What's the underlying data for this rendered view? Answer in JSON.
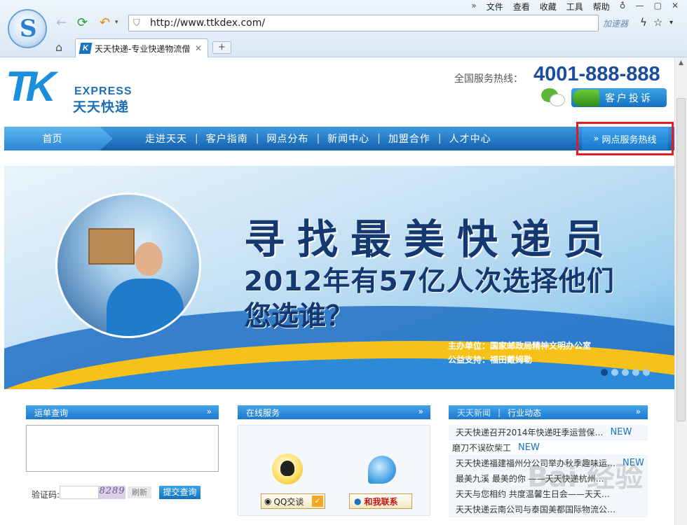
{
  "browser": {
    "menu": [
      "文件",
      "查看",
      "收藏",
      "工具",
      "帮助"
    ],
    "url": "http://www.ttkdex.com/",
    "accelerator": "加速器",
    "tab_title": "天天快递-专业快递物流僧",
    "tab_icon_text": "K",
    "colors": {
      "chrome": "#dbe8f4",
      "accent": "#1c6fb8"
    }
  },
  "header": {
    "logo_mark": "TK",
    "logo_express": "EXPRESS",
    "logo_cn": "天天快递",
    "hotline_label": "全国服务热线：",
    "hotline_number": "4001-888-888",
    "complain_label": "客户投诉"
  },
  "nav": {
    "home": "首页",
    "items": [
      "走进天天",
      "客户指南",
      "网点分布",
      "新闻中心",
      "加盟合作",
      "人才中心"
    ],
    "highlight": "网点服务热线",
    "highlight_prefix": "»"
  },
  "banner": {
    "headline": "寻找最美快递员",
    "line2": "2012年有57亿人次选择他们",
    "line3": "您选谁？",
    "credit1": "主办单位：国家邮政局精神文明办公室",
    "credit2": "公益支持：福田戴姆勒",
    "dots": 5,
    "active_dot": 0
  },
  "waybill": {
    "title": "运单查询",
    "captcha_label": "验证码:",
    "captcha_value": "8289",
    "refresh": "刷新",
    "submit": "提交查询"
  },
  "online": {
    "title": "在线服务",
    "qq_label": "QQ交谈",
    "ww_label": "和我联系"
  },
  "news": {
    "tab1": "天天新闻",
    "tab2": "行业动态",
    "new_badge": "NEW",
    "items": [
      {
        "text": "天天快递召开2014年快递旺季运营保…",
        "new": true
      },
      {
        "text": "磨刀不误砍柴工",
        "new": true
      },
      {
        "text": "天天快递福建福州分公司举办秋季趣味运…",
        "new": true
      },
      {
        "text": "最美九溪 最美的你 ——天天快递杭州…",
        "new": false
      },
      {
        "text": "天天与您相约 共度温馨生日会——天天…",
        "new": false
      },
      {
        "text": "天天快递云南公司与泰国美都国际物流公…",
        "new": false
      }
    ]
  },
  "watermark": "Bai 经验"
}
